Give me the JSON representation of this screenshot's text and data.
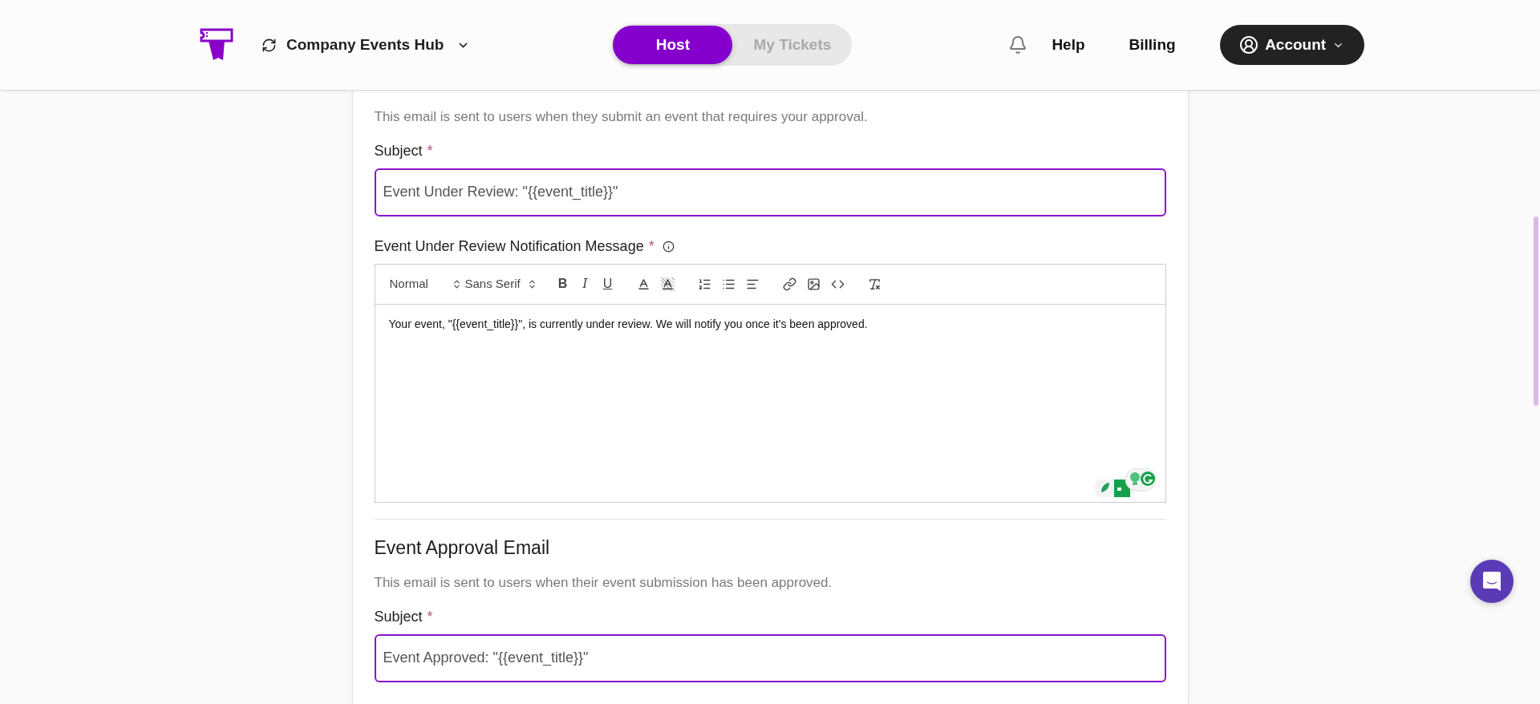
{
  "header": {
    "workspace": {
      "name": "Company Events Hub"
    },
    "mode_tabs": [
      {
        "label": "Host",
        "selected": true
      },
      {
        "label": "My Tickets",
        "selected": false
      }
    ],
    "nav_links": [
      "Help",
      "Billing"
    ],
    "account": {
      "label": "Account"
    }
  },
  "sections": [
    {
      "description": "This email is sent to users when they submit an event that requires your approval.",
      "subject_label": "Subject",
      "required_mark": "*",
      "subject_value": "Event Under Review: \"{{event_title}}\"",
      "message": {
        "label": "Event Under Review Notification Message",
        "required_mark": "*",
        "toolbar_groups": [
          {
            "items": [
              {
                "kind": "select",
                "label": "Normal"
              },
              {
                "kind": "select",
                "label": "Sans Serif"
              }
            ]
          },
          {
            "items": [
              {
                "kind": "bold",
                "label": "B"
              },
              {
                "kind": "italic",
                "label": "I"
              },
              {
                "kind": "underline",
                "label": "U"
              }
            ]
          },
          {
            "items": [
              {
                "kind": "color"
              },
              {
                "kind": "highlight"
              }
            ]
          },
          {
            "items": [
              {
                "kind": "numbered"
              },
              {
                "kind": "bullets"
              },
              {
                "kind": "align"
              }
            ]
          },
          {
            "items": [
              {
                "kind": "link"
              },
              {
                "kind": "image"
              },
              {
                "kind": "code"
              }
            ]
          },
          {
            "items": [
              {
                "kind": "clean"
              }
            ]
          }
        ],
        "body": "Your event, \"{{event_title}}\", is currently under review. We will notify you once it's been approved."
      }
    },
    {
      "title": "Event Approval Email",
      "description": "This email is sent to users when their event submission has been approved.",
      "subject_label": "Subject",
      "required_mark": "*",
      "subject_value": "Event Approved: \"{{event_title}}\""
    }
  ]
}
